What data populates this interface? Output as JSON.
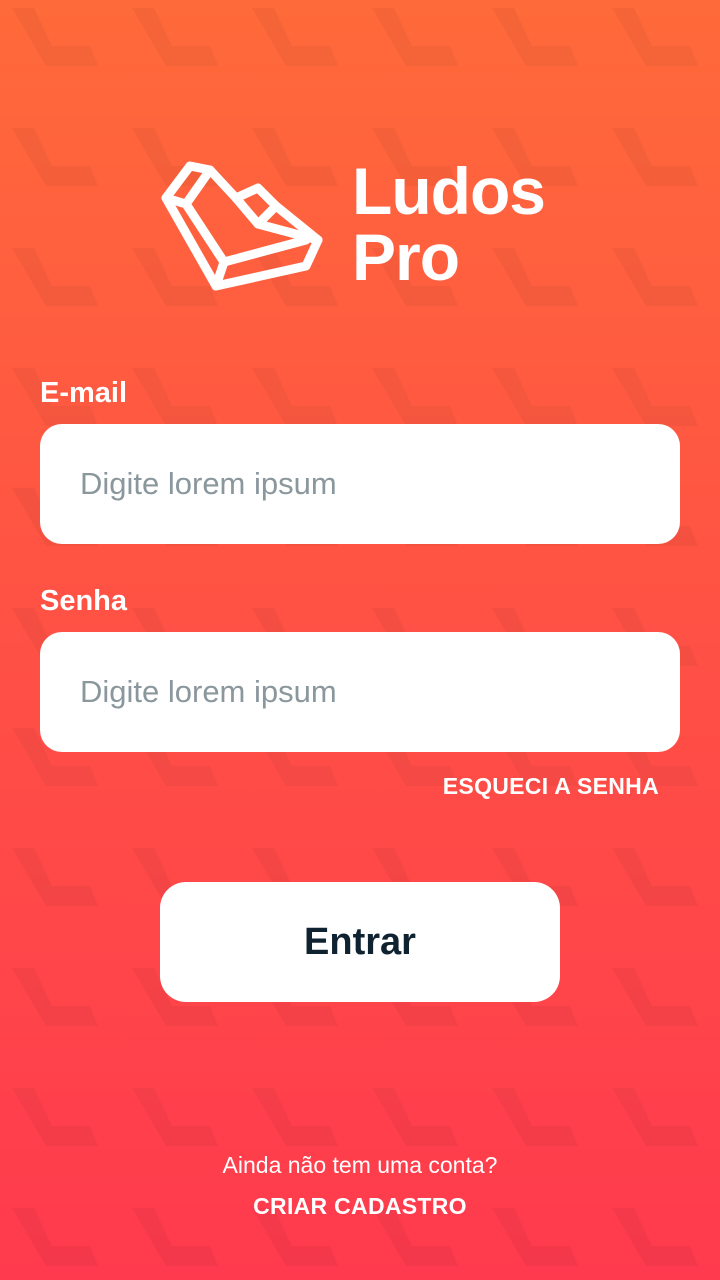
{
  "logo": {
    "line1": "Ludos",
    "line2": "Pro",
    "icon": "ludos-pro-logo-icon"
  },
  "form": {
    "email_label": "E-mail",
    "email_placeholder": "Digite lorem ipsum",
    "password_label": "Senha",
    "password_placeholder": "Digite lorem ipsum",
    "forgot_label": "ESQUECI A SENHA",
    "submit_label": "Entrar"
  },
  "footer": {
    "question": "Ainda não tem uma conta?",
    "signup_label": "CRIAR CADASTRO"
  },
  "colors": {
    "gradient_top": "#ff6a3a",
    "gradient_bottom": "#ff3a4e",
    "button_text": "#0f2230",
    "placeholder": "#8a979d"
  }
}
